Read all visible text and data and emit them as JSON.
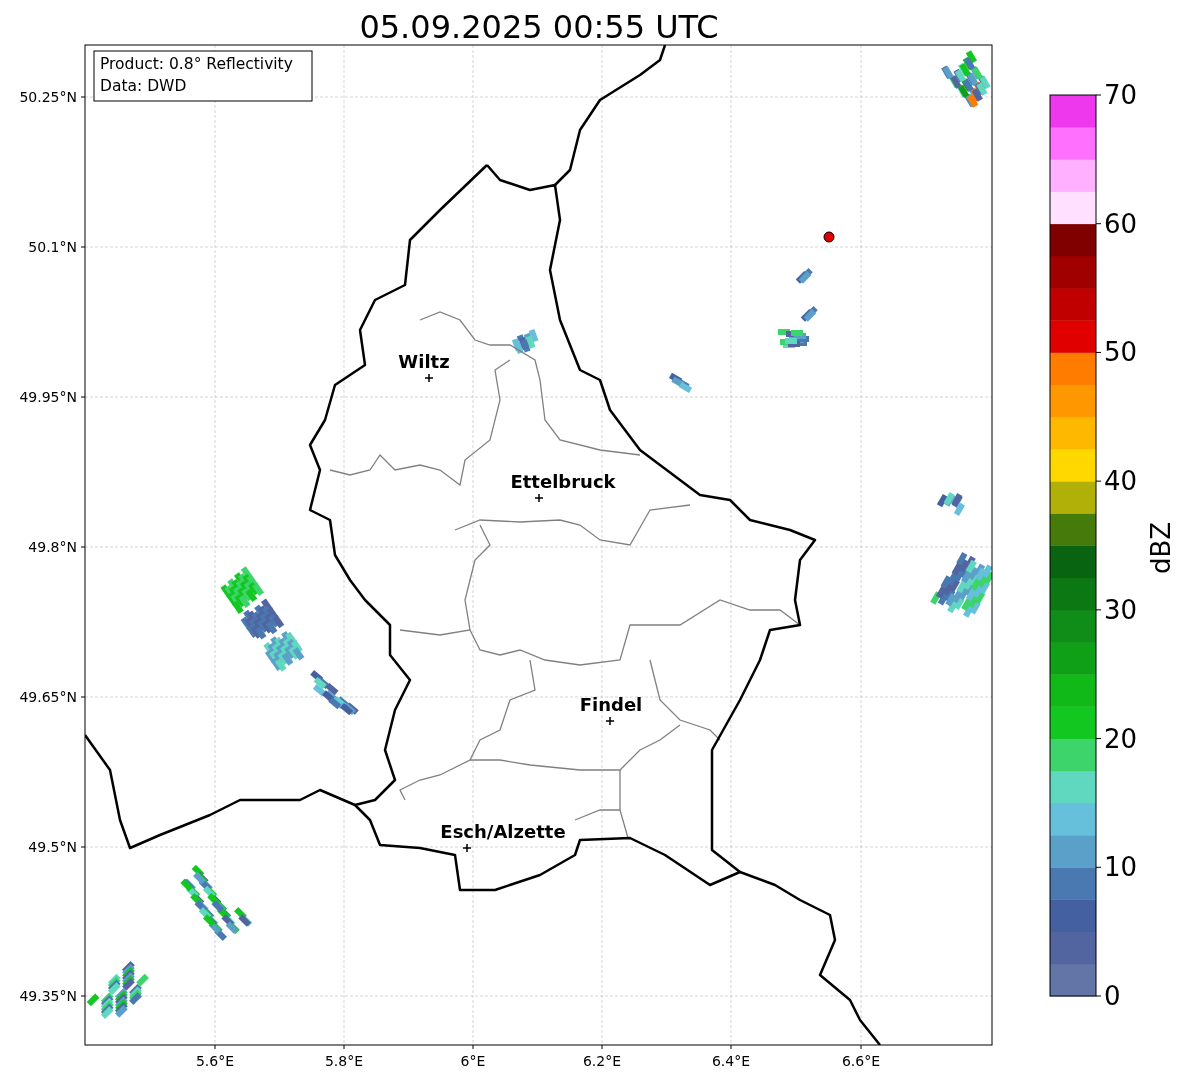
{
  "title": "05.09.2025 00:55 UTC",
  "info_box": [
    "Product: 0.8° Reflectivity",
    "Data: DWD"
  ],
  "y_ticks": [
    "50.25°N",
    "50.1°N",
    "49.95°N",
    "49.8°N",
    "49.65°N",
    "49.5°N",
    "49.35°N"
  ],
  "x_ticks": [
    "5.6°E",
    "5.8°E",
    "6°E",
    "6.2°E",
    "6.4°E",
    "6.6°E"
  ],
  "places": [
    {
      "name": "Wiltz"
    },
    {
      "name": "Ettelbruck"
    },
    {
      "name": "Findel"
    },
    {
      "name": "Esch/Alzette"
    }
  ],
  "colorbar": {
    "label": "dBZ",
    "ticks": [
      "70",
      "60",
      "50",
      "40",
      "30",
      "20",
      "10",
      "0"
    ],
    "segments": [
      {
        "color": "#6374a6"
      },
      {
        "color": "#5265a0"
      },
      {
        "color": "#4560a0"
      },
      {
        "color": "#4a78b0"
      },
      {
        "color": "#5ba0c8"
      },
      {
        "color": "#66c0dc"
      },
      {
        "color": "#60d8c0"
      },
      {
        "color": "#3ed46c"
      },
      {
        "color": "#12c820"
      },
      {
        "color": "#10b818"
      },
      {
        "color": "#10a018"
      },
      {
        "color": "#108c18"
      },
      {
        "color": "#0c7814"
      },
      {
        "color": "#086410"
      },
      {
        "color": "#467a0a"
      },
      {
        "color": "#b0b008"
      },
      {
        "color": "#ffd800"
      },
      {
        "color": "#ffb800"
      },
      {
        "color": "#ff9800"
      },
      {
        "color": "#ff7c00"
      },
      {
        "color": "#e00000"
      },
      {
        "color": "#c00000"
      },
      {
        "color": "#a00000"
      },
      {
        "color": "#800000"
      },
      {
        "color": "#ffe0ff"
      },
      {
        "color": "#ffb0ff"
      },
      {
        "color": "#ff70ff"
      },
      {
        "color": "#ee38ee"
      }
    ]
  }
}
